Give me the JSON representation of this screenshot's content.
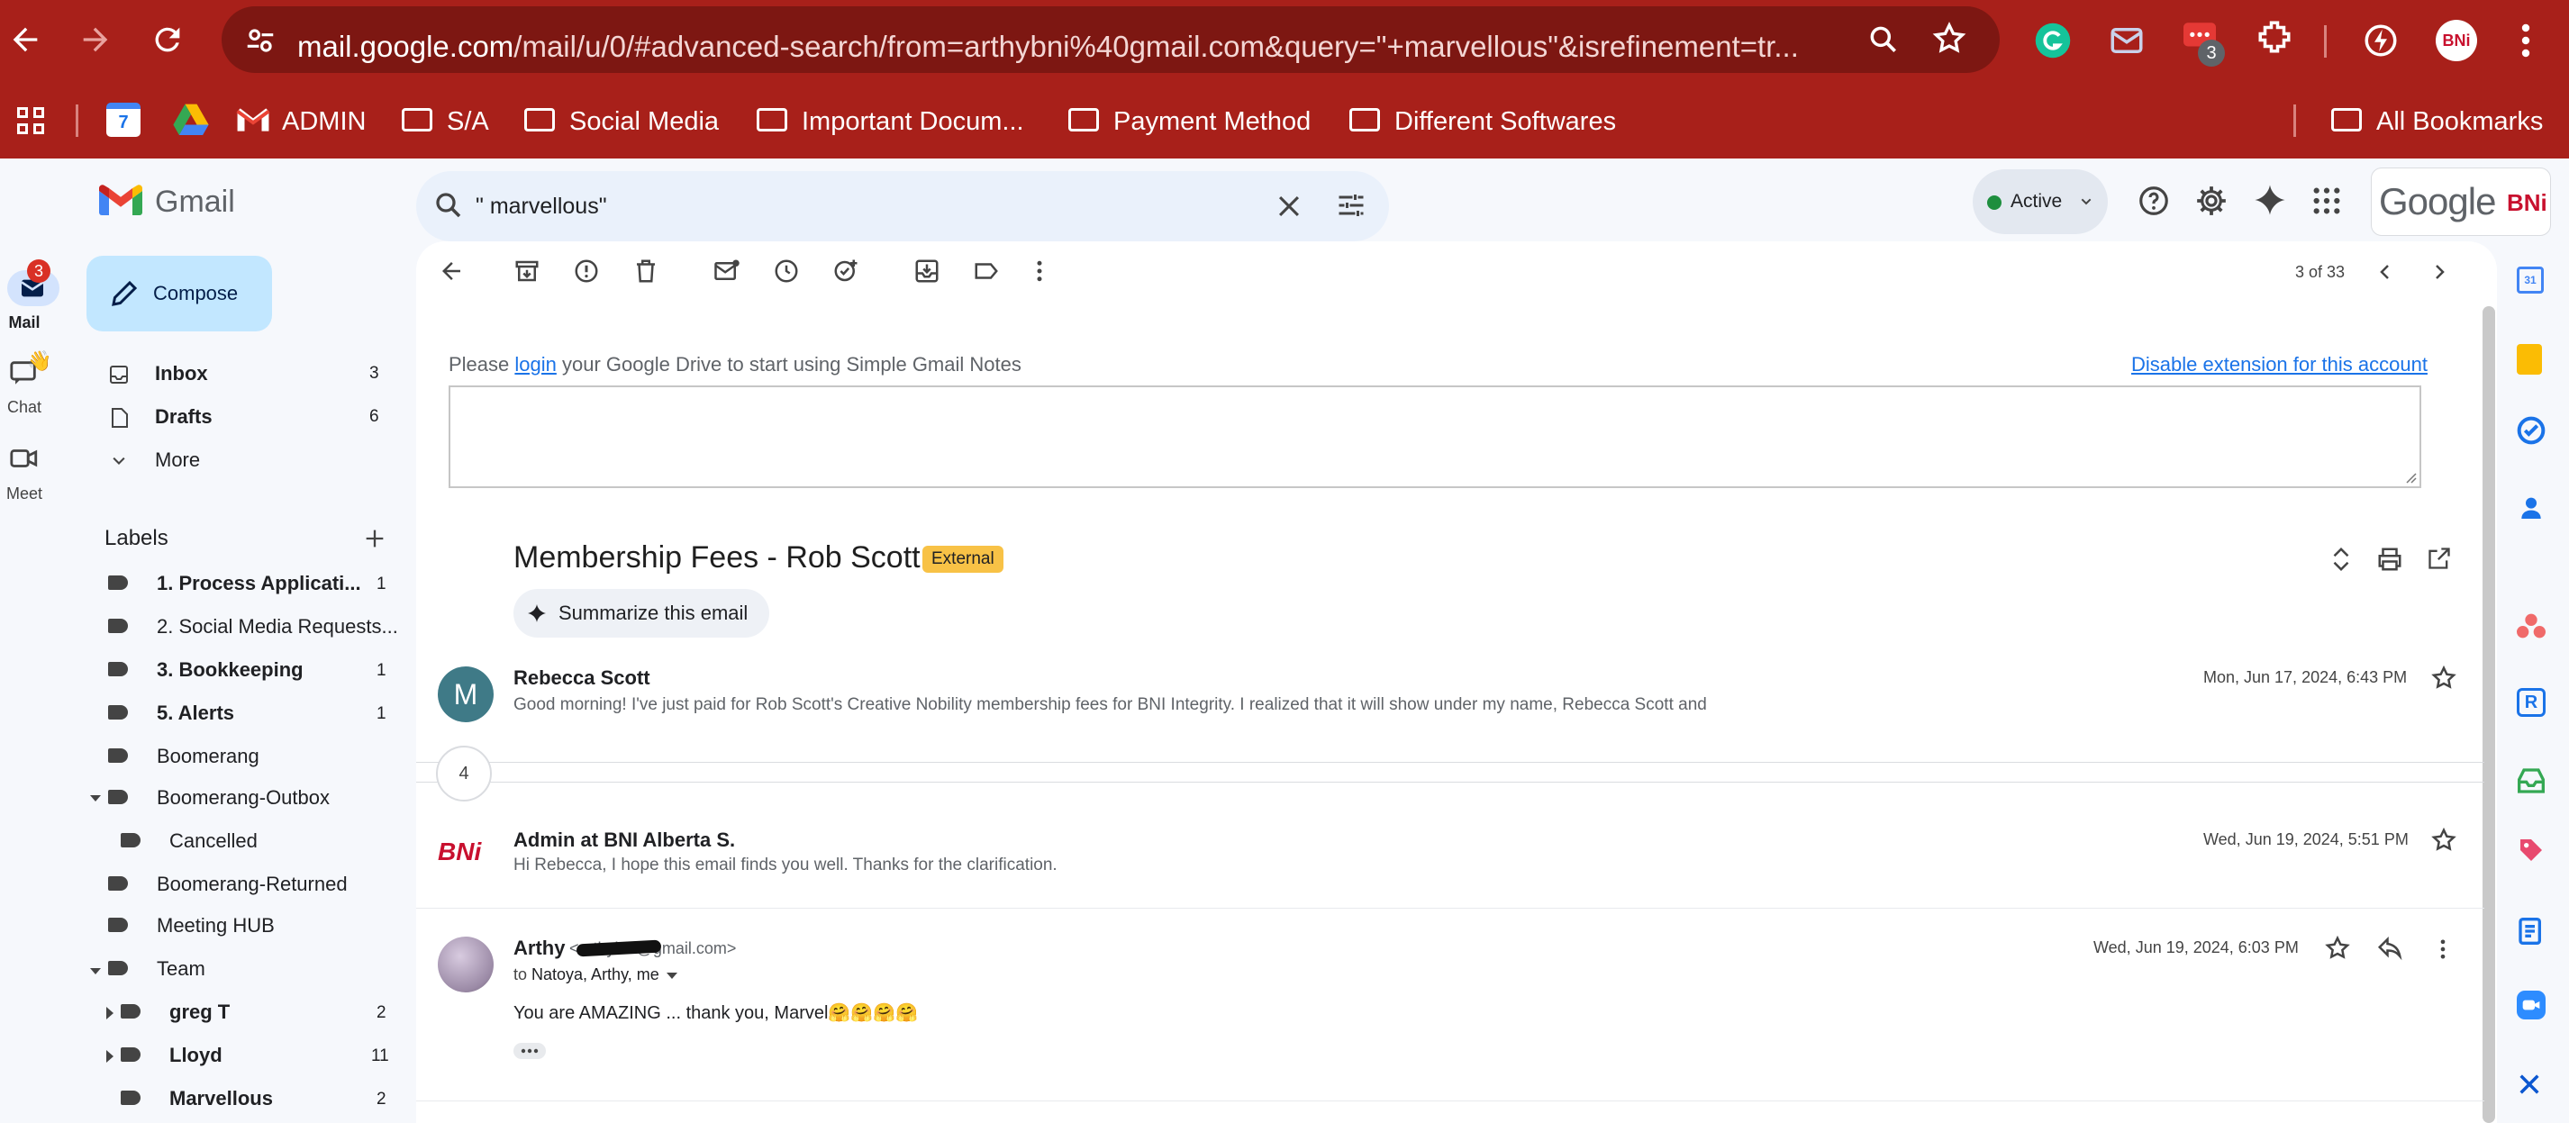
{
  "browser": {
    "url_host": "mail.google.com",
    "url_rest": "/mail/u/0/#advanced-search/from=arthybni%40gmail.com&query=\"+marvellous\"&isrefinement=tr...",
    "extension_badge": "3",
    "profile_initials": "BNi",
    "bookmarks": [
      "ADMIN",
      "S/A",
      "Social Media",
      "Important Docum...",
      "Payment Method",
      "Different Softwares"
    ],
    "all_bookmarks": "All Bookmarks",
    "calendar_day": "7"
  },
  "gmail": {
    "app_name": "Gmail",
    "search_value": "\" marvellous\"",
    "status": "Active",
    "brand": "Google",
    "compose": "Compose",
    "rail": {
      "mail": "Mail",
      "mail_badge": "3",
      "chat": "Chat",
      "meet": "Meet"
    },
    "nav": [
      {
        "label": "Inbox",
        "count": "3"
      },
      {
        "label": "Drafts",
        "count": "6"
      },
      {
        "label": "More",
        "count": ""
      }
    ],
    "labels_title": "Labels",
    "labels": [
      {
        "label": "1. Process Applicati...",
        "count": "1"
      },
      {
        "label": "2. Social Media Requests...",
        "count": ""
      },
      {
        "label": "3. Bookkeeping",
        "count": "1"
      },
      {
        "label": "5. Alerts",
        "count": "1"
      },
      {
        "label": "Boomerang",
        "count": ""
      },
      {
        "label": "Boomerang-Outbox",
        "count": ""
      },
      {
        "label": "Cancelled",
        "count": ""
      },
      {
        "label": "Boomerang-Returned",
        "count": ""
      },
      {
        "label": "Meeting HUB",
        "count": ""
      },
      {
        "label": "Team",
        "count": ""
      },
      {
        "label": "greg T",
        "count": "2"
      },
      {
        "label": "Lloyd",
        "count": "11"
      },
      {
        "label": "Marvellous",
        "count": "2"
      }
    ],
    "pager": "3 of 33"
  },
  "notes": {
    "pre": "Please ",
    "link": "login",
    "post": " your Google Drive to start using Simple Gmail Notes",
    "disable": "Disable extension for this account"
  },
  "thread": {
    "subject": "Membership Fees - Rob Scott",
    "badge": "External",
    "summarize": "Summarize this email",
    "collapsed_count": "4",
    "messages": [
      {
        "avatar": "M",
        "sender": "Rebecca Scott",
        "date": "Mon, Jun 17, 2024, 6:43 PM",
        "snippet": "Good morning! I've just paid for Rob Scott's Creative Nobility membership fees for BNI Integrity. I realized that it will show under my name, Rebecca Scott and"
      },
      {
        "avatar": "BNi",
        "sender": "Admin at BNI Alberta S.",
        "date": "Wed, Jun 19, 2024, 5:51 PM",
        "snippet": "Hi Rebecca, I hope this email finds you well. Thanks for the clarification."
      },
      {
        "sender": "Arthy",
        "email": "<arthybni@gmail.com>",
        "date": "Wed, Jun 19, 2024, 6:03 PM",
        "to_prefix": "to ",
        "to": "Natoya, Arthy, me",
        "body": "You are AMAZING ... thank you, Marvel🤗🤗🤗🤗"
      }
    ]
  },
  "colors": {
    "chrome": "#a8201a",
    "gmail_bg": "#f6f8fc",
    "compose": "#c2e7ff",
    "external_badge": "#f8c246",
    "link": "#1a73e8"
  }
}
